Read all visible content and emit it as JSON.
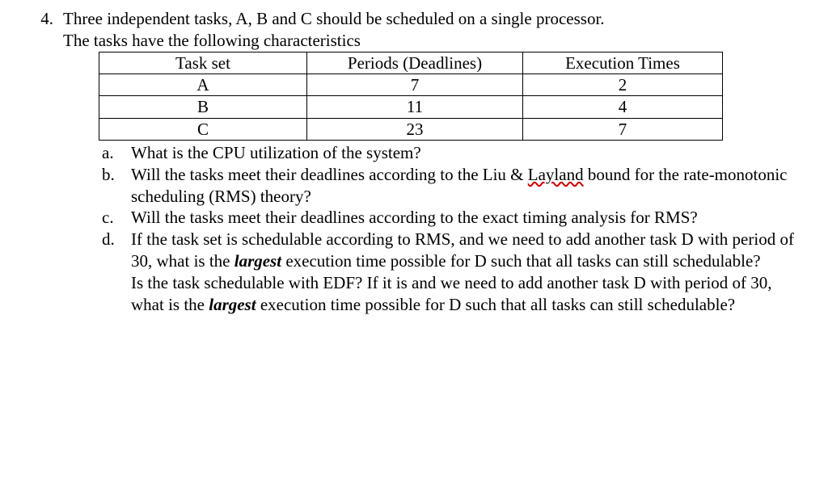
{
  "question_number": "4.",
  "intro_line1": "Three independent tasks, A, B and C should be scheduled on a single processor.",
  "intro_line2": "The tasks have the following characteristics",
  "table": {
    "headers": [
      "Task set",
      "Periods (Deadlines)",
      "Execution Times"
    ],
    "rows": [
      [
        "A",
        "7",
        "2"
      ],
      [
        "B",
        "11",
        "4"
      ],
      [
        "C",
        "23",
        "7"
      ]
    ]
  },
  "subparts": {
    "a": {
      "letter": "a.",
      "text": "What is the CPU utilization of the system?"
    },
    "b": {
      "letter": "b.",
      "pre": "Will the tasks meet their deadlines according to the Liu & ",
      "underlined": "Layland",
      "post": " bound for the rate-monotonic scheduling (RMS) theory?"
    },
    "c": {
      "letter": "c.",
      "text": "Will the tasks meet their deadlines according to the exact timing analysis for RMS?"
    },
    "d": {
      "letter": "d.",
      "seg1": "If the task set is schedulable according to RMS, and we need to add another task D with period of 30, what is the ",
      "largest1": "largest",
      "seg2": " execution time possible for D such that all tasks can still schedulable?",
      "seg3": "Is the task schedulable with EDF? If it is and we need to add another task D with period of 30, what is the ",
      "largest2": "largest",
      "seg4": " execution time possible for D such that all tasks can still schedulable?"
    }
  }
}
